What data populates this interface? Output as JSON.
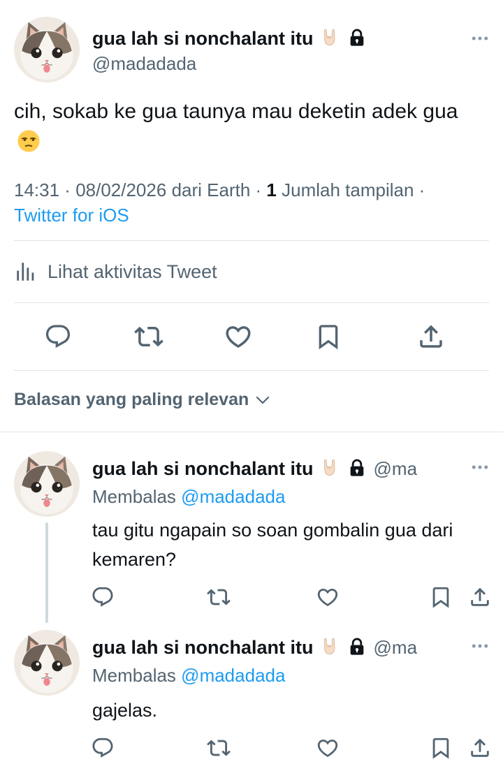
{
  "main_tweet": {
    "display_name": "gua lah si nonchalant itu",
    "name_emoji": "🤘🏻",
    "handle": "@madadada",
    "text": "cih, sokab ke gua taunya mau deketin adek gua",
    "text_emoji": "😒",
    "time": "14:31",
    "date": "08/02/2026",
    "location_label": "dari Earth",
    "view_count": "1",
    "view_label": "Jumlah tampilan",
    "client": "Twitter for iOS",
    "activity_label": "Lihat aktivitas Tweet"
  },
  "sort": {
    "label": "Balasan yang paling relevan"
  },
  "replies": [
    {
      "display_name": "gua lah si nonchalant itu",
      "name_emoji": "🤘🏻",
      "handle": "@ma",
      "replying_prefix": "Membalas",
      "replying_to": "@madadada",
      "text": "tau gitu ngapain so soan gombalin gua dari kemaren?"
    },
    {
      "display_name": "gua lah si nonchalant itu",
      "name_emoji": "🤘🏻",
      "handle": "@ma",
      "replying_prefix": "Membalas",
      "replying_to": "@madadada",
      "text": "gajelas."
    }
  ],
  "icons": {
    "reply": "reply-icon",
    "retweet": "retweet-icon",
    "like": "like-icon",
    "bookmark": "bookmark-icon",
    "share": "share-icon",
    "more": "more-icon",
    "lock": "lock-icon",
    "analytics": "analytics-icon",
    "chevron": "chevron-down-icon"
  },
  "colors": {
    "text": "#0f1419",
    "secondary": "#536471",
    "link": "#1d9bf0",
    "divider": "#dfe3e6"
  }
}
